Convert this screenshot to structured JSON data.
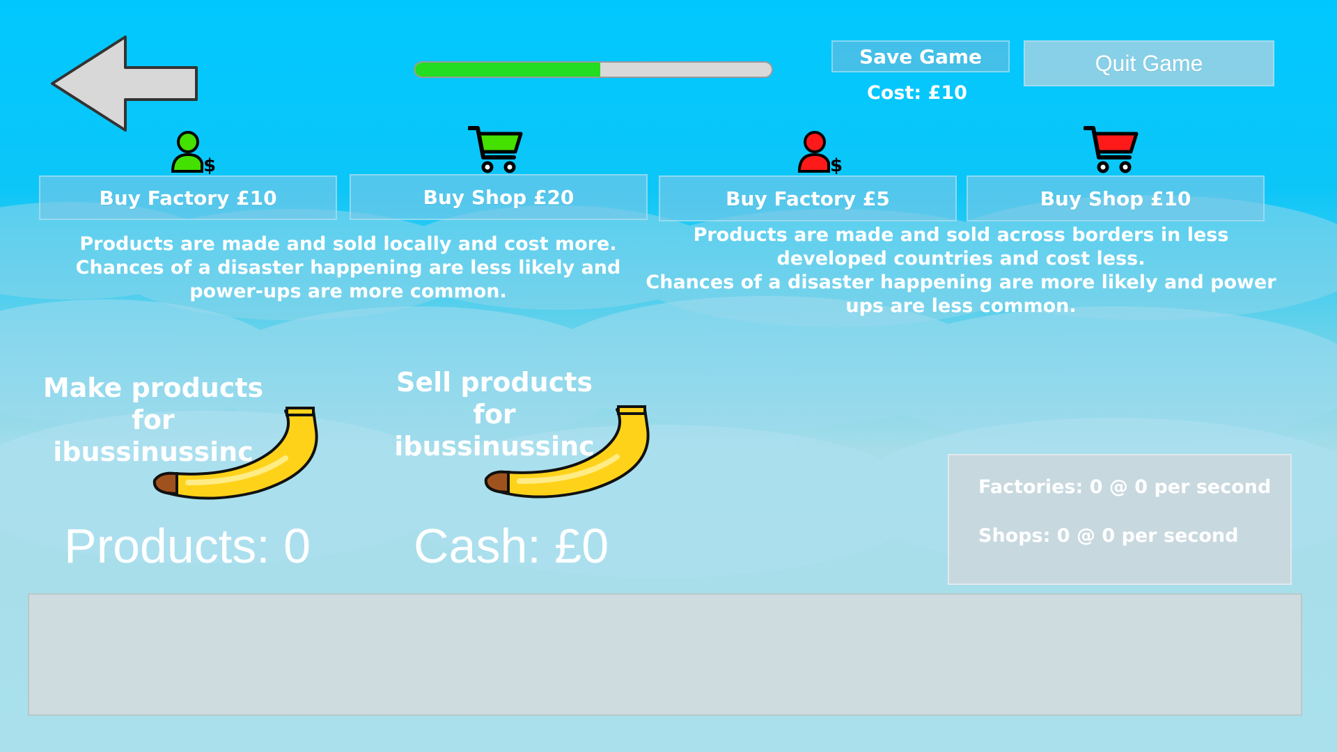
{
  "header": {
    "back_icon": "left-arrow-icon",
    "progress_fraction": 0.52,
    "save_label": "Save Game",
    "save_cost": "Cost: £10",
    "quit_label": "Quit Game"
  },
  "local": {
    "factory_icon": "person-dollar-icon",
    "shop_icon": "shopping-cart-icon",
    "icon_color": "#44e000",
    "buy_factory_label": "Buy Factory £10",
    "buy_shop_label": "Buy Shop £20",
    "description": "Products are made and sold locally and cost more.\nChances of a disaster happening are less likely and\npower-ups are more common."
  },
  "overseas": {
    "factory_icon": "person-dollar-icon",
    "shop_icon": "shopping-cart-icon",
    "icon_color": "#ff1a1a",
    "buy_factory_label": "Buy Factory £5",
    "buy_shop_label": "Buy Shop £10",
    "description": "Products are made and sold across borders in less\ndeveloped countries and cost less.\nChances of a disaster happening are more likely and power\nups are less common."
  },
  "actions": {
    "make_label": "Make products for\nibussinussinc",
    "sell_label": "Sell products for\nibussinussinc",
    "banana_icon": "banana-icon"
  },
  "counters": {
    "products": "Products: 0",
    "cash": "Cash: £0"
  },
  "stats": {
    "factories": "Factories: 0 @ 0 per second",
    "shops": "Shops: 0 @ 0 per second"
  }
}
